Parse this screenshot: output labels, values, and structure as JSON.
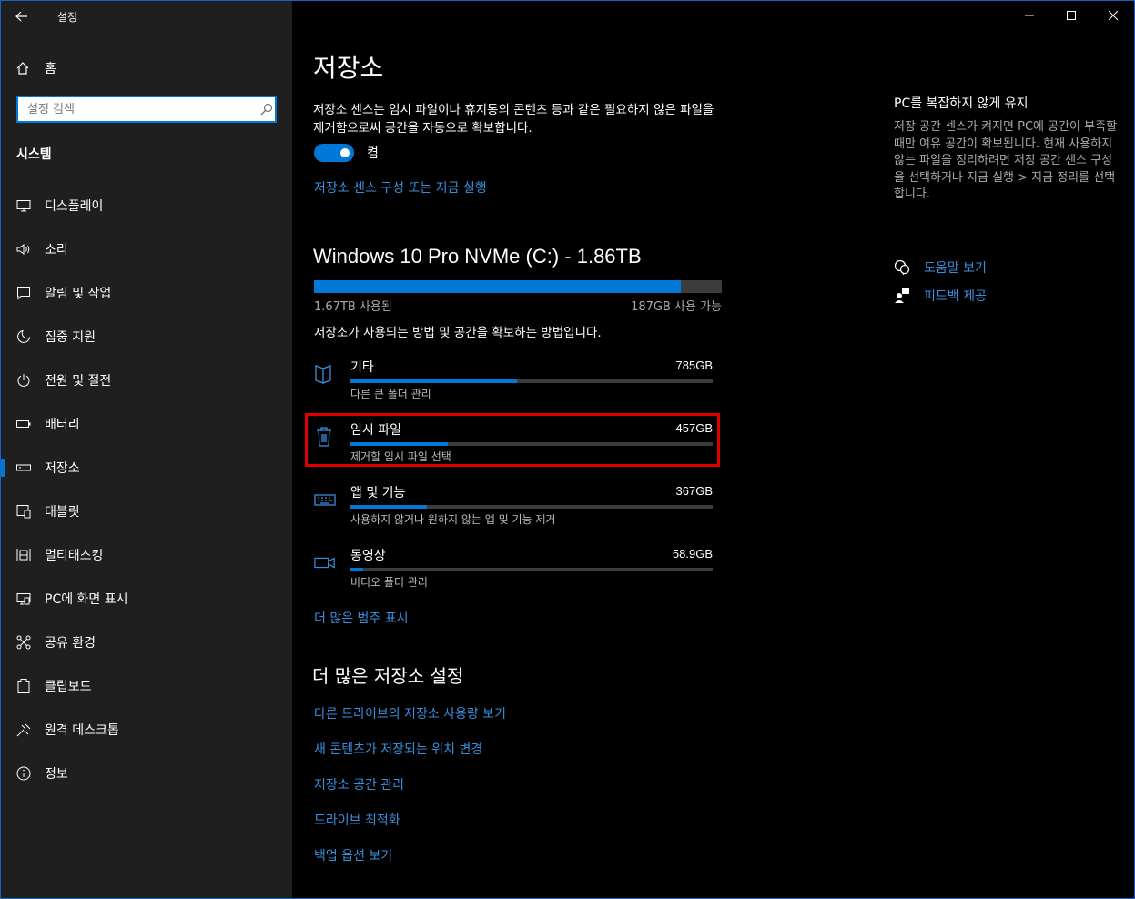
{
  "app_title": "설정",
  "sidebar": {
    "home_label": "홈",
    "search_placeholder": "설정 검색",
    "section_title": "시스템",
    "items": [
      {
        "label": "디스플레이",
        "icon": "monitor-icon"
      },
      {
        "label": "소리",
        "icon": "speaker-icon"
      },
      {
        "label": "알림 및 작업",
        "icon": "notification-icon"
      },
      {
        "label": "집중 지원",
        "icon": "moon-icon"
      },
      {
        "label": "전원 및 절전",
        "icon": "power-icon"
      },
      {
        "label": "배터리",
        "icon": "battery-icon"
      },
      {
        "label": "저장소",
        "icon": "storage-icon",
        "active": true
      },
      {
        "label": "태블릿",
        "icon": "tablet-icon"
      },
      {
        "label": "멀티태스킹",
        "icon": "multitasking-icon"
      },
      {
        "label": "PC에 화면 표시",
        "icon": "project-icon"
      },
      {
        "label": "공유 환경",
        "icon": "share-icon"
      },
      {
        "label": "클립보드",
        "icon": "clipboard-icon"
      },
      {
        "label": "원격 데스크톱",
        "icon": "remote-desktop-icon"
      },
      {
        "label": "정보",
        "icon": "info-icon"
      }
    ]
  },
  "main": {
    "title": "저장소",
    "sense_description": "저장소 센스는 임시 파일이나 휴지통의 콘텐츠 등과 같은 필요하지 않은 파일을 제거함으로써 공간을 자동으로 확보합니다.",
    "toggle_state": "켬",
    "sense_link": "저장소 센스 구성 또는 지금 실행",
    "drive": {
      "title": "Windows 10 Pro NVMe (C:) - 1.86TB",
      "used": "1.67TB 사용됨",
      "free": "187GB 사용 가능",
      "used_fraction": 0.9,
      "description": "저장소가 사용되는 방법 및 공간을 확보하는 방법입니다."
    },
    "categories": [
      {
        "name": "기타",
        "size": "785GB",
        "sub": "다른 큰 폴더 관리",
        "fraction": 0.46,
        "icon": "folder-icon"
      },
      {
        "name": "임시 파일",
        "size": "457GB",
        "sub": "제거할 임시 파일 선택",
        "fraction": 0.27,
        "icon": "trash-icon"
      },
      {
        "name": "앱 및 기능",
        "size": "367GB",
        "sub": "사용하지 않거나 원하지 않는 앱 및 기능 제거",
        "fraction": 0.21,
        "icon": "keyboard-icon"
      },
      {
        "name": "동영상",
        "size": "58.9GB",
        "sub": "비디오 폴더 관리",
        "fraction": 0.035,
        "icon": "video-icon"
      }
    ],
    "more_categories_link": "더 많은 범주 표시",
    "more_settings_title": "더 많은 저장소 설정",
    "more_links": [
      "다른 드라이브의 저장소 사용량 보기",
      "새 콘텐츠가 저장되는 위치 변경",
      "저장소 공간 관리",
      "드라이브 최적화",
      "백업 옵션 보기"
    ]
  },
  "aside": {
    "title": "PC를 복잡하지 않게 유지",
    "text": "저장 공간 센스가 켜지면 PC에 공간이 부족할 때만 여유 공간이 확보됩니다. 현재 사용하지 않는 파일을 정리하려면 저장 공간 센스 구성을 선택하거나 지금 실행 > 지금 정리를 선택합니다.",
    "help_link": "도움말 보기",
    "feedback_link": "피드백 제공"
  }
}
